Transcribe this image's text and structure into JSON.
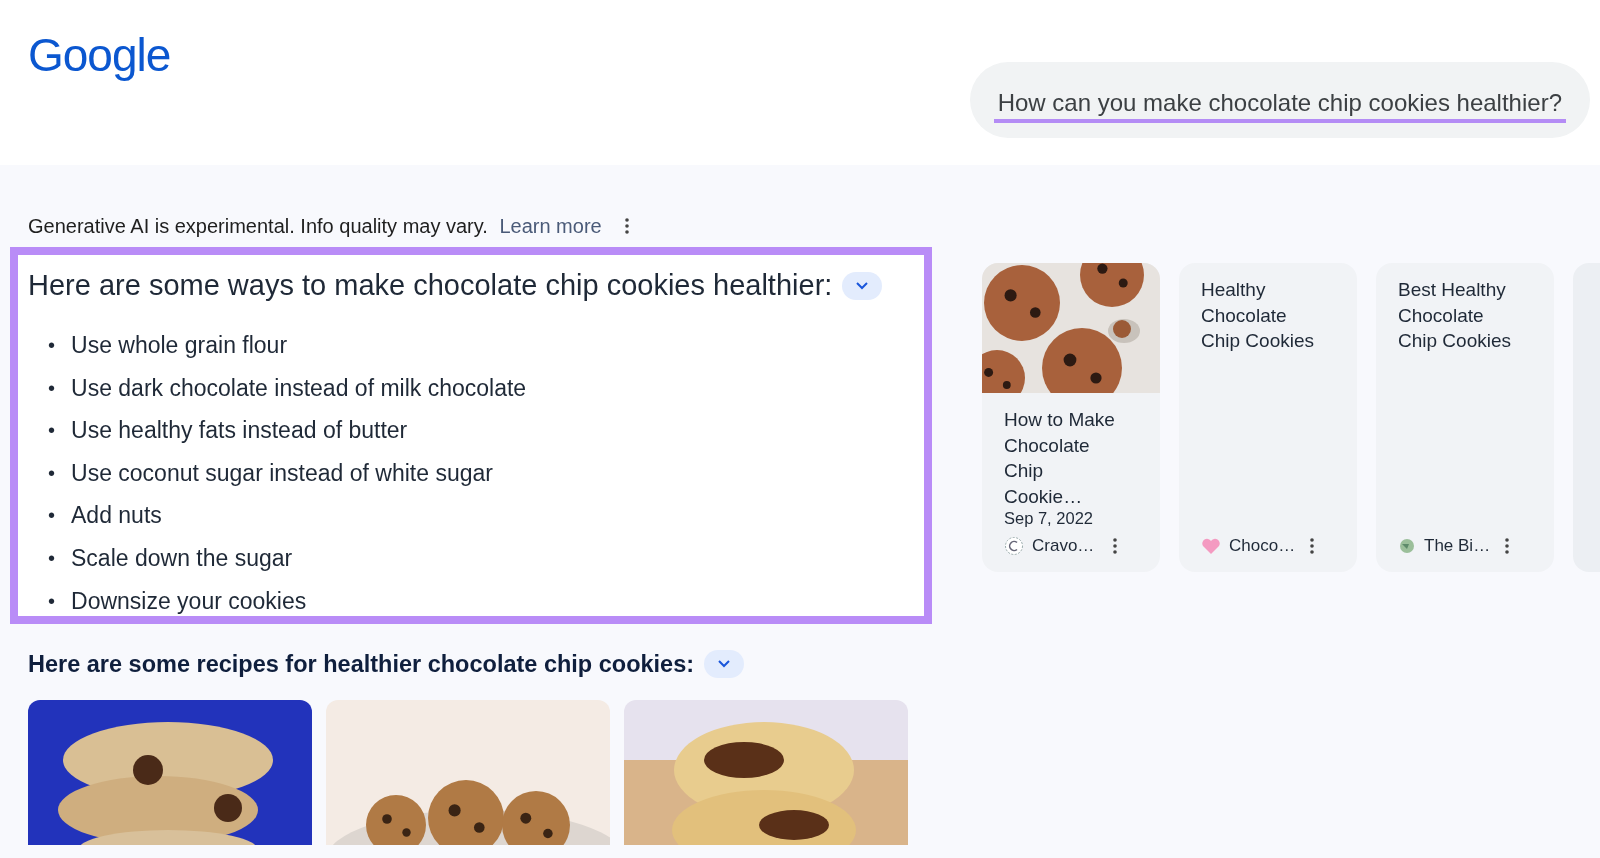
{
  "header": {
    "logo": "Google",
    "search": {
      "value": "How can you make chocolate chip cookies healthier?"
    }
  },
  "disclaimer": {
    "text": "Generative AI is experimental. Info quality may vary.",
    "link": "Learn more"
  },
  "answer": {
    "heading": "Here are some ways to make chocolate chip cookies healthier:",
    "expanded": true,
    "bullet": "•",
    "items": [
      "Use whole grain flour",
      "Use dark chocolate instead of milk chocolate",
      "Use healthy fats instead of butter",
      "Use coconut sugar instead of white sugar",
      "Add nuts",
      "Scale down the sugar",
      "Downsize your cookies"
    ]
  },
  "sources": [
    {
      "title": "How to Make Chocolate Chip Cookie…",
      "date": "Sep 7, 2022",
      "site": "Cravo…"
    },
    {
      "kind": "text",
      "title": "Healthy Chocolate Chip Cookies",
      "site": "Choco…"
    },
    {
      "kind": "text",
      "title": "Best Healthy Chocolate Chip Cookies",
      "site": "The Bi…"
    }
  ],
  "recipes": {
    "heading": "Here are some recipes for healthier chocolate chip cookies:",
    "expanded": true
  }
}
